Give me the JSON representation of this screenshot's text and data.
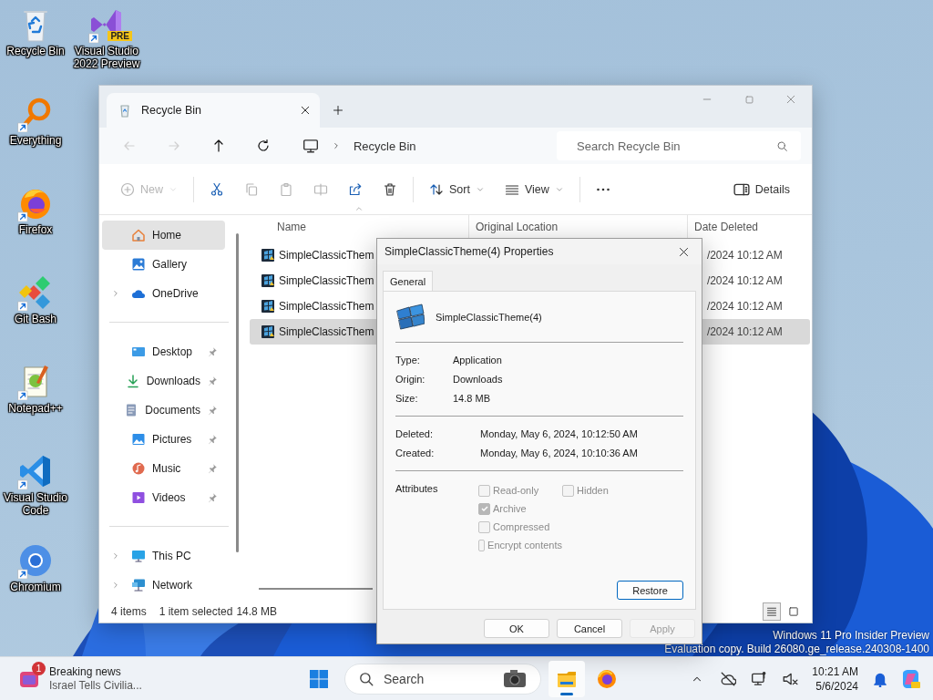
{
  "desktop": {
    "icons": [
      {
        "label": "Recycle Bin",
        "kind": "recycle",
        "shortcut": false
      },
      {
        "label": "Visual Studio 2022 Preview",
        "kind": "studio",
        "shortcut": true,
        "badge": "PRE"
      },
      {
        "label": "Everything",
        "kind": "magnifier",
        "shortcut": true
      },
      {
        "label": "Firefox",
        "kind": "firefox",
        "shortcut": true
      },
      {
        "label": "Git Bash",
        "kind": "git",
        "shortcut": true
      },
      {
        "label": "Notepad++",
        "kind": "notepad",
        "shortcut": true
      },
      {
        "label": "Visual Studio Code",
        "kind": "code",
        "shortcut": true
      },
      {
        "label": "Chromium",
        "kind": "chromium",
        "shortcut": true
      }
    ],
    "edition_notice": [
      "Windows 11 Pro Insider Preview",
      "Evaluation copy. Build 26080.ge_release.240308-1400"
    ]
  },
  "explorer": {
    "tab": {
      "title": "Recycle Bin",
      "selected": true
    },
    "nav_buttons": [
      {
        "kind": "back",
        "disabled": true
      },
      {
        "kind": "forward",
        "disabled": true
      },
      {
        "kind": "up",
        "disabled": false
      },
      {
        "kind": "refresh",
        "disabled": false
      }
    ],
    "address": {
      "path": [
        "Recycle Bin"
      ]
    },
    "search": {
      "placeholder": "Search Recycle Bin"
    },
    "toolbar": [
      {
        "kind": "new",
        "label": "New",
        "disabled": true,
        "dropdown": true
      },
      {
        "kind": "cut",
        "disabled": false
      },
      {
        "kind": "copy",
        "disabled": true
      },
      {
        "kind": "paste",
        "disabled": true
      },
      {
        "kind": "rename",
        "disabled": true
      },
      {
        "kind": "share",
        "disabled": false
      },
      {
        "kind": "delete",
        "disabled": false
      },
      {
        "kind": "sort",
        "label": "Sort",
        "disabled": false,
        "dropdown": true
      },
      {
        "kind": "view",
        "label": "View",
        "disabled": false,
        "dropdown": true
      },
      {
        "kind": "more",
        "disabled": false
      }
    ],
    "details_button": {
      "label": "Details"
    },
    "sidebar": {
      "groups": [
        [
          {
            "label": "Home",
            "kind": "home",
            "selected": true,
            "expandable": false,
            "pinned": false
          },
          {
            "label": "Gallery",
            "kind": "gallery",
            "selected": false,
            "expandable": false,
            "pinned": false
          },
          {
            "label": "OneDrive",
            "kind": "cloud",
            "selected": false,
            "expandable": true,
            "pinned": false
          }
        ],
        [
          {
            "label": "Desktop",
            "kind": "desktop",
            "selected": false,
            "expandable": false,
            "pinned": true
          },
          {
            "label": "Downloads",
            "kind": "downloads",
            "selected": false,
            "expandable": false,
            "pinned": true
          },
          {
            "label": "Documents",
            "kind": "documents",
            "selected": false,
            "expandable": false,
            "pinned": true
          },
          {
            "label": "Pictures",
            "kind": "pictures",
            "selected": false,
            "expandable": false,
            "pinned": true
          },
          {
            "label": "Music",
            "kind": "music",
            "selected": false,
            "expandable": false,
            "pinned": true
          },
          {
            "label": "Videos",
            "kind": "videos",
            "selected": false,
            "expandable": false,
            "pinned": true
          }
        ],
        [
          {
            "label": "This PC",
            "kind": "pc",
            "selected": false,
            "expandable": true,
            "pinned": false
          },
          {
            "label": "Network",
            "kind": "network",
            "selected": false,
            "expandable": true,
            "pinned": false
          }
        ]
      ]
    },
    "columns": [
      {
        "label": "Name",
        "sorted": true
      },
      {
        "label": "Original Location",
        "sorted": false
      },
      {
        "label": "Date Deleted",
        "sorted": false
      }
    ],
    "rows": [
      {
        "name": "SimpleClassicThem",
        "date_deleted": "/2024 10:12 AM",
        "selected": false
      },
      {
        "name": "SimpleClassicThem",
        "date_deleted": "/2024 10:12 AM",
        "selected": false
      },
      {
        "name": "SimpleClassicThem",
        "date_deleted": "/2024 10:12 AM",
        "selected": false
      },
      {
        "name": "SimpleClassicThem",
        "date_deleted": "/2024 10:12 AM",
        "selected": true
      }
    ],
    "status": {
      "count": "4 items",
      "selection": "1 item selected",
      "size": "14.8 MB"
    },
    "views": [
      {
        "kind": "details",
        "selected": true
      },
      {
        "kind": "tiles",
        "selected": false
      }
    ]
  },
  "properties_dialog": {
    "title": "SimpleClassicTheme(4) Properties",
    "tabs": [
      {
        "label": "General",
        "selected": true
      }
    ],
    "file_name": "SimpleClassicTheme(4)",
    "info": [
      {
        "label": "Type:",
        "value": "Application"
      },
      {
        "label": "Origin:",
        "value": "Downloads"
      },
      {
        "label": "Size:",
        "value": "14.8 MB"
      }
    ],
    "dates": [
      {
        "label": "Deleted:",
        "value": "Monday, May 6, 2024, 10:12:50 AM"
      },
      {
        "label": "Created:",
        "value": "Monday, May 6, 2024, 10:10:36 AM"
      }
    ],
    "attributes_label": "Attributes",
    "attributes": [
      {
        "label": "Read-only",
        "checked": false,
        "disabled": true
      },
      {
        "label": "Hidden",
        "checked": false,
        "disabled": true
      },
      {
        "label": "Archive",
        "checked": true,
        "disabled": true
      },
      {
        "label": "Compressed",
        "checked": false,
        "disabled": true
      },
      {
        "label": "Encrypt contents",
        "checked": false,
        "disabled": true
      }
    ],
    "restore_button": "Restore",
    "buttons": [
      {
        "label": "OK",
        "disabled": false
      },
      {
        "label": "Cancel",
        "disabled": false
      },
      {
        "label": "Apply",
        "disabled": true
      }
    ]
  },
  "taskbar": {
    "news": {
      "badge": "1",
      "title": "Breaking news",
      "subtitle": "Israel Tells Civilia..."
    },
    "search": {
      "placeholder": "Search"
    },
    "apps": [
      {
        "kind": "explorer",
        "running": true
      },
      {
        "kind": "firefox",
        "running": false
      }
    ],
    "time": "10:21 AM",
    "date": "5/6/2024"
  }
}
